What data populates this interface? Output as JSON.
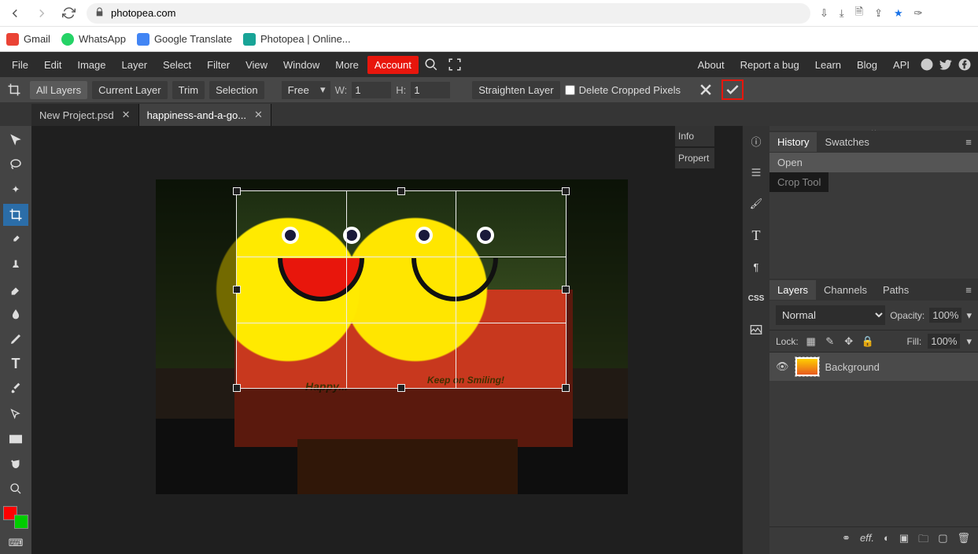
{
  "browser": {
    "url": "photopea.com",
    "bookmarks": [
      {
        "label": "Gmail",
        "color": "#ea4335"
      },
      {
        "label": "WhatsApp",
        "color": "#25d366"
      },
      {
        "label": "Google Translate",
        "color": "#4285f4"
      },
      {
        "label": "Photopea | Online...",
        "color": "#18a497"
      }
    ]
  },
  "menubar": {
    "items": [
      "File",
      "Edit",
      "Image",
      "Layer",
      "Select",
      "Filter",
      "View",
      "Window",
      "More"
    ],
    "account": "Account",
    "right": [
      "About",
      "Report a bug",
      "Learn",
      "Blog",
      "API"
    ]
  },
  "options": {
    "crop_icon": "crop",
    "all_layers": "All Layers",
    "current_layer": "Current Layer",
    "trim": "Trim",
    "selection": "Selection",
    "ratio": "Free",
    "w_label": "W:",
    "w_val": "1",
    "h_label": "H:",
    "h_val": "1",
    "straighten": "Straighten Layer",
    "delete_cropped": "Delete Cropped Pixels"
  },
  "tabs": [
    {
      "label": "New Project.psd"
    },
    {
      "label": "happiness-and-a-go..."
    }
  ],
  "info_stub": {
    "info": "Info",
    "properties": "Propert"
  },
  "history_panel": {
    "tabs": [
      "History",
      "Swatches"
    ],
    "items": [
      "Open",
      "Crop Tool"
    ]
  },
  "layers_panel": {
    "tabs": [
      "Layers",
      "Channels",
      "Paths"
    ],
    "blend": "Normal",
    "opacity_label": "Opacity:",
    "opacity_val": "100%",
    "lock_label": "Lock:",
    "fill_label": "Fill:",
    "fill_val": "100%",
    "layer_name": "Background"
  },
  "image_text": {
    "left": "Happy...",
    "right": "Keep on Smiling!"
  }
}
